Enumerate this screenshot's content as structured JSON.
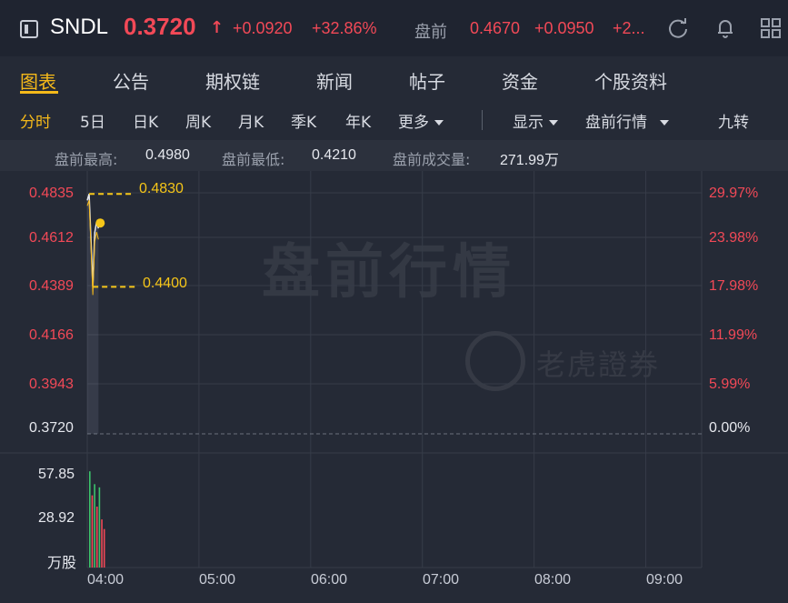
{
  "header": {
    "symbol": "SNDL",
    "price": "0.3720",
    "arrow": "↑",
    "change": "+0.0920",
    "change_pct": "+32.86%",
    "premarket_label": "盘前",
    "premarket_price": "0.4670",
    "premarket_change": "+0.0950",
    "premarket_change_pct": "+2...",
    "icons": [
      "chart-toggle-icon",
      "refresh-icon",
      "bell-icon",
      "grid-icon"
    ]
  },
  "tabs": [
    {
      "label": "图表",
      "active": true
    },
    {
      "label": "公告"
    },
    {
      "label": "期权链"
    },
    {
      "label": "新闻"
    },
    {
      "label": "帖子"
    },
    {
      "label": "资金"
    },
    {
      "label": "个股资料"
    }
  ],
  "periods": {
    "items": [
      "分时",
      "5日",
      "日K",
      "周K",
      "月K",
      "季K",
      "年K"
    ],
    "more": "更多",
    "display": "显示",
    "premarket": "盘前行情",
    "nine_turn": "九转"
  },
  "stats": {
    "high_label": "盘前最高:",
    "high_value": "0.4980",
    "low_label": "盘前最低:",
    "low_value": "0.4210",
    "vol_label": "盘前成交量:",
    "vol_value": "271.99万"
  },
  "watermark": {
    "main": "盘前行情",
    "brand": "老虎證券"
  },
  "colors": {
    "up": "#f24957",
    "accent": "#f5b91a",
    "volume_up": "#3cc36b",
    "volume_down": "#f24957"
  },
  "chart_data": {
    "type": "line",
    "price_axis_left": [
      "0.4835",
      "0.4612",
      "0.4389",
      "0.4166",
      "0.3943",
      "0.3720"
    ],
    "price_axis_right": [
      "29.97%",
      "23.98%",
      "17.98%",
      "11.99%",
      "5.99%",
      "0.00%"
    ],
    "ylim": [
      0.372,
      0.4835
    ],
    "volume_axis": [
      "57.85",
      "28.92",
      "万股"
    ],
    "x_ticks": [
      "04:00",
      "05:00",
      "06:00",
      "07:00",
      "08:00",
      "09:00"
    ],
    "annotations": {
      "high": "0.4830",
      "low": "0.4400"
    },
    "series": [
      {
        "x": [
          "04:00",
          "04:01",
          "04:02",
          "04:03",
          "04:04",
          "04:05",
          "04:06"
        ],
        "values": [
          0.48,
          0.483,
          0.462,
          0.44,
          0.465,
          0.47,
          0.467
        ]
      }
    ],
    "volume": {
      "x": [
        "04:00",
        "04:01",
        "04:02",
        "04:03",
        "04:04",
        "04:05",
        "04:06"
      ],
      "values": [
        60,
        45,
        52,
        38,
        50,
        30,
        24
      ],
      "colors": [
        "up",
        "down",
        "up",
        "down",
        "up",
        "down",
        "down"
      ]
    }
  }
}
